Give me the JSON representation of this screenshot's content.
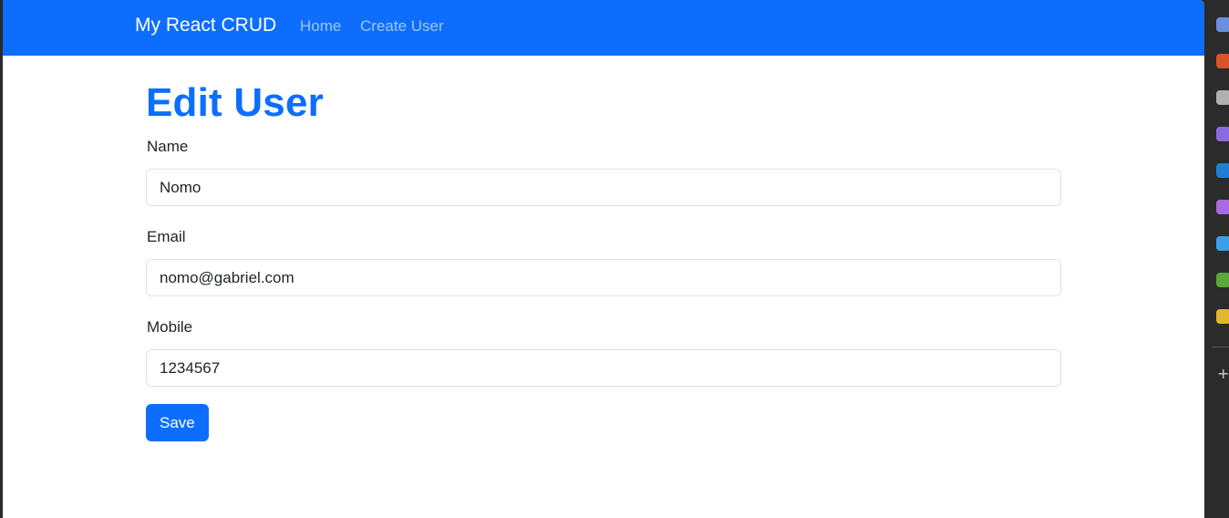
{
  "navbar": {
    "brand": "My React CRUD",
    "links": [
      "Home",
      "Create User"
    ]
  },
  "page": {
    "title": "Edit User"
  },
  "form": {
    "name_label": "Name",
    "name_value": "Nomo",
    "email_label": "Email",
    "email_value": "nomo@gabriel.com",
    "mobile_label": "Mobile",
    "mobile_value": "1234567",
    "save_label": "Save"
  },
  "sidebar": {
    "icons": [
      {
        "name": "tag-icon",
        "color": "#6a8fdc"
      },
      {
        "name": "toolbox-icon",
        "color": "#d9542a"
      },
      {
        "name": "people-icon",
        "color": "#b0b0b0"
      },
      {
        "name": "copilot-icon",
        "color": "#8a6ae0"
      },
      {
        "name": "outlook-icon",
        "color": "#1f7fd6"
      },
      {
        "name": "music-icon",
        "color": "#a86ae0"
      },
      {
        "name": "send-icon",
        "color": "#3aa0e8"
      },
      {
        "name": "tree-icon",
        "color": "#5aa83a"
      },
      {
        "name": "games-icon",
        "color": "#e0b82a"
      }
    ],
    "add_label": "+"
  },
  "colors": {
    "primary": "#0d6efd",
    "text": "#212529",
    "border": "#dee2e6"
  }
}
